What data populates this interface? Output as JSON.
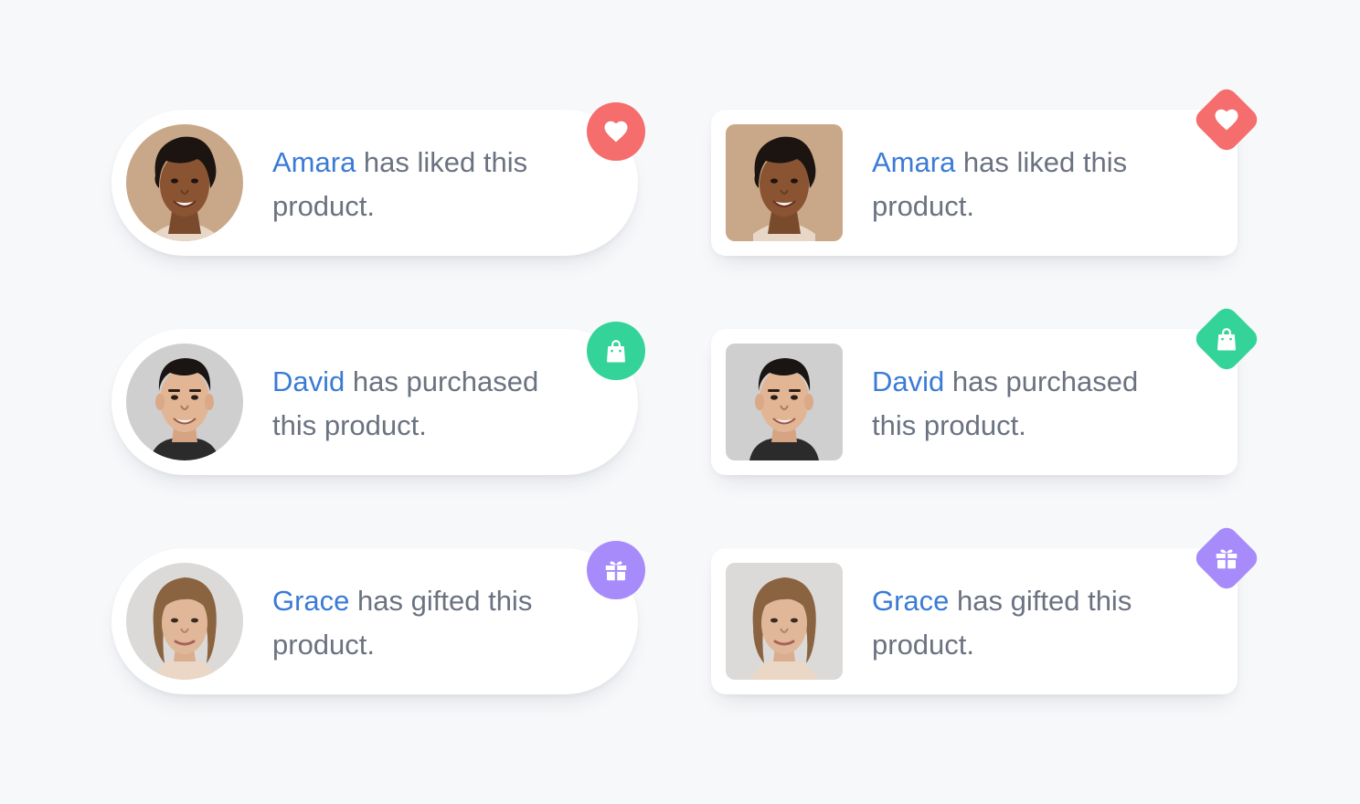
{
  "colors": {
    "background": "#f7f8fa",
    "name_link": "#3a7bd5",
    "message_text": "#6b7280",
    "like_badge": "#f56d6d",
    "purchase_badge": "#34d399",
    "gift_badge": "#a78bfa"
  },
  "notifications": [
    {
      "style": "pill",
      "avatar_shape": "circle",
      "badge_shape": "circle",
      "name": "Amara",
      "action_text": " has liked this product.",
      "icon": "heart-icon"
    },
    {
      "style": "rounded-rect",
      "avatar_shape": "rounded-square",
      "badge_shape": "diamond",
      "name": "Amara",
      "action_text": " has liked this product.",
      "icon": "heart-icon"
    },
    {
      "style": "pill",
      "avatar_shape": "circle",
      "badge_shape": "circle",
      "name": "David",
      "action_text": " has purchased this product.",
      "icon": "shopping-bag-icon"
    },
    {
      "style": "rounded-rect",
      "avatar_shape": "rounded-square",
      "badge_shape": "diamond",
      "name": "David",
      "action_text": " has purchased this product.",
      "icon": "shopping-bag-icon"
    },
    {
      "style": "pill",
      "avatar_shape": "circle",
      "badge_shape": "circle",
      "name": "Grace",
      "action_text": " has gifted this product.",
      "icon": "gift-icon"
    },
    {
      "style": "rounded-rect",
      "avatar_shape": "rounded-square",
      "badge_shape": "diamond",
      "name": "Grace",
      "action_text": " has gifted this product.",
      "icon": "gift-icon"
    }
  ]
}
